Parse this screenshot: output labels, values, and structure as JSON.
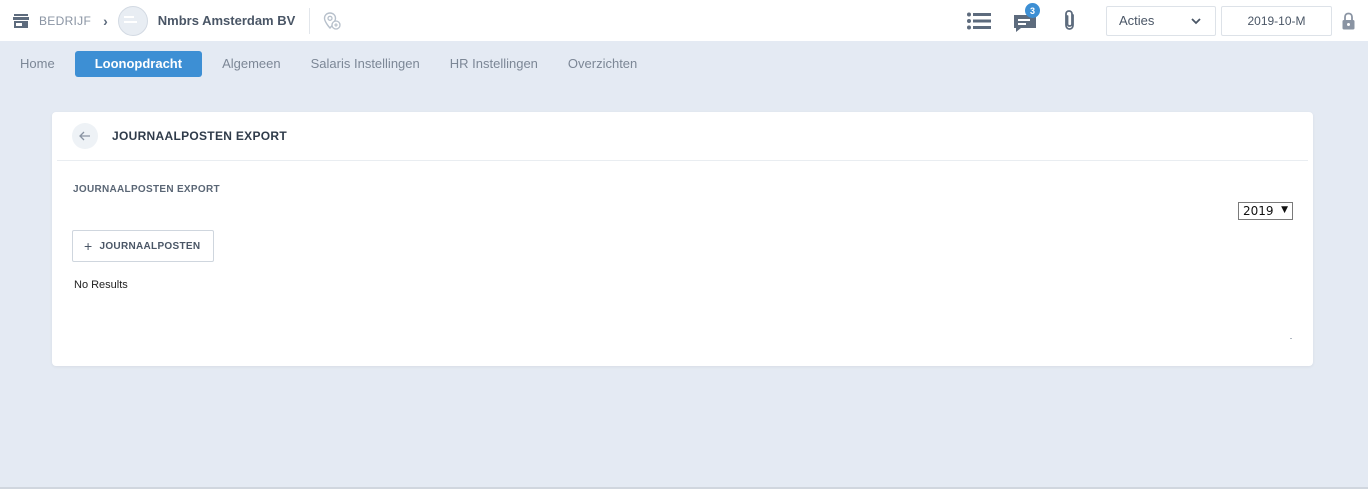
{
  "topbar": {
    "company_type": "BEDRIJF",
    "company_name": "Nmbrs Amsterdam BV",
    "chat_badge": "3",
    "actions_label": "Acties",
    "period_label": "2019-10-M"
  },
  "nav": {
    "items": [
      {
        "label": "Home"
      },
      {
        "label": "Loonopdracht",
        "active": true
      },
      {
        "label": "Algemeen"
      },
      {
        "label": "Salaris Instellingen"
      },
      {
        "label": "HR Instellingen"
      },
      {
        "label": "Overzichten"
      }
    ]
  },
  "card": {
    "title": "JOURNAALPOSTEN EXPORT",
    "section_title": "JOURNAALPOSTEN EXPORT",
    "year_selected": "2019",
    "add_button_label": "JOURNAALPOSTEN",
    "empty_text": "No Results"
  },
  "icons": {
    "store": "store-icon",
    "chevron": "chevron-right-icon",
    "pin": "location-pin-icon",
    "list": "list-icon",
    "chat": "chat-icon",
    "clip": "paperclip-icon",
    "dropdown": "chevron-down-icon",
    "lock": "lock-icon",
    "back": "arrow-left-icon",
    "plus": "plus-icon"
  },
  "colors": {
    "accent": "#3d8fd4",
    "background": "#e4eaf3"
  }
}
